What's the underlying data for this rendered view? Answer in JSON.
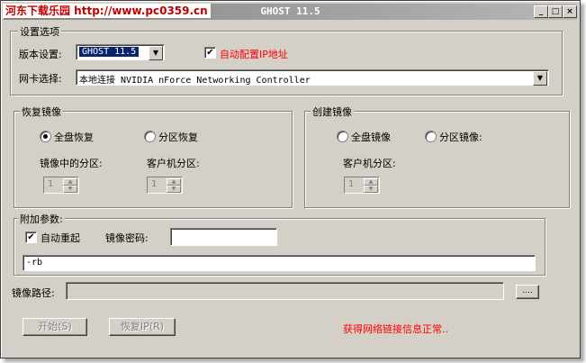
{
  "window": {
    "title": "GHOST 11.5",
    "watermark": "河东下载乐园 http://www.pc0359.cn",
    "controls": {
      "minimize": "_",
      "maximize": "□",
      "close": "×"
    }
  },
  "settings": {
    "legend": "设置选项",
    "version_label": "版本设置:",
    "version_value": "GHOST 11.5",
    "auto_ip_label": "自动配置IP地址",
    "auto_ip_checked": "✔",
    "nic_label": "网卡选择:",
    "nic_value": "本地连接  NVIDIA nForce Networking Controller"
  },
  "restore": {
    "legend": "恢复镜像",
    "full_label": "全盘恢复",
    "partition_label": "分区恢复",
    "image_partition_label": "镜像中的分区:",
    "client_partition_label": "客户机分区:",
    "image_partition_value": "1",
    "client_partition_value": "1"
  },
  "create": {
    "legend": "创建镜像",
    "full_label": "全盘镜像",
    "partition_label": "分区镜像:",
    "client_partition_label": "客户机分区:",
    "client_partition_value": "1"
  },
  "extra": {
    "legend": "附加参数:",
    "auto_reboot_label": "自动重起",
    "auto_reboot_checked": "✔",
    "password_label": "镜像密码:",
    "password_value": "",
    "args_value": "-rb"
  },
  "path": {
    "label": "镜像路径:",
    "value": "",
    "browse_label": "...."
  },
  "buttons": {
    "start": "开始(S)",
    "restore_ip": "恢复IP(R)"
  },
  "status": {
    "text": "获得网络链接信息正常..",
    "color": "#ff0000"
  }
}
